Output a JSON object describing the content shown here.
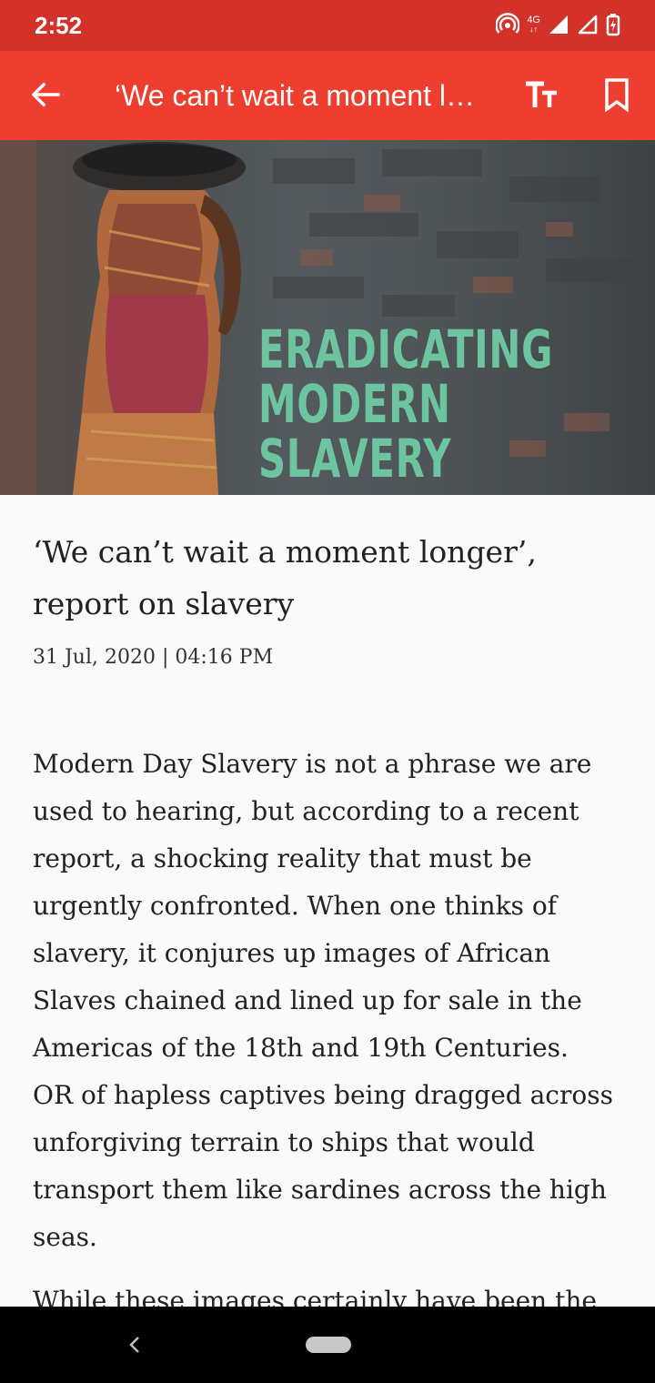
{
  "status_bar": {
    "time": "2:52",
    "network_label": "4G"
  },
  "app_bar": {
    "title": "‘We can’t wait a moment longer’, report on slavery",
    "back_icon": "arrow-left-icon",
    "font_size_icon": "text-size-icon",
    "bookmark_icon": "bookmark-icon"
  },
  "hero": {
    "overlay_lines": [
      "ERADICATING",
      "MODERN",
      "SLAVERY"
    ],
    "overlay_color": "#6cc59f"
  },
  "article": {
    "headline": "‘We can’t wait a moment longer’, report on slavery",
    "date": "31 Jul, 2020 | 04:16 PM",
    "paragraphs": [
      "Modern Day Slavery is not a phrase we are used to hearing, but according to a recent report, a shocking reality that must be urgently confronted. When one thinks of slavery, it conjures up images of African Slaves chained and lined up for sale in the Americas of the 18th and 19th Centuries. OR of hapless captives being dragged across unforgiving terrain to ships that would transport them like sardines across the high seas.",
      "While these images certainly have been the"
    ]
  },
  "colors": {
    "status_bar": "#d3322a",
    "app_bar": "#ee3e30",
    "background": "#fafafa"
  }
}
